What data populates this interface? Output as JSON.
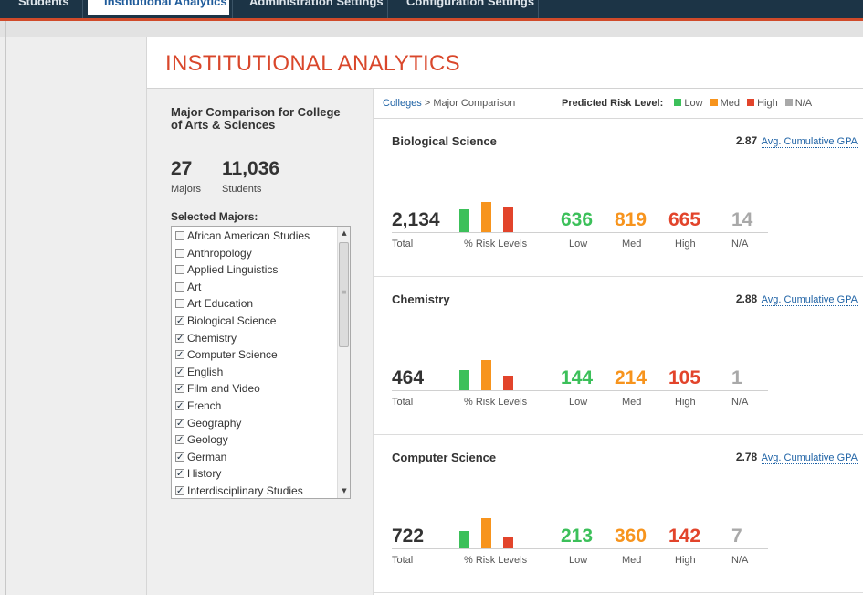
{
  "nav": {
    "tabs": [
      "Students",
      "Institutional Analytics",
      "Administration Settings",
      "Configuration Settings"
    ]
  },
  "page": {
    "title": "INSTITUTIONAL ANALYTICS"
  },
  "sidebar": {
    "heading": "Major Comparison for College of Arts & Sciences",
    "majors_count": "27",
    "majors_label": "Majors",
    "students_count": "11,036",
    "students_label": "Students",
    "selected_label": "Selected Majors:",
    "majors": [
      {
        "label": "African American Studies",
        "checked": false
      },
      {
        "label": "Anthropology",
        "checked": false
      },
      {
        "label": "Applied Linguistics",
        "checked": false
      },
      {
        "label": "Art",
        "checked": false
      },
      {
        "label": "Art Education",
        "checked": false
      },
      {
        "label": "Biological Science",
        "checked": true
      },
      {
        "label": "Chemistry",
        "checked": true
      },
      {
        "label": "Computer Science",
        "checked": true
      },
      {
        "label": "English",
        "checked": true
      },
      {
        "label": "Film and Video",
        "checked": true
      },
      {
        "label": "French",
        "checked": true
      },
      {
        "label": "Geography",
        "checked": true
      },
      {
        "label": "Geology",
        "checked": true
      },
      {
        "label": "German",
        "checked": true
      },
      {
        "label": "History",
        "checked": true
      },
      {
        "label": "Interdisciplinary Studies",
        "checked": true
      }
    ]
  },
  "breadcrumb": {
    "link": "Colleges",
    "sep": " > ",
    "current": "Major Comparison"
  },
  "legend": {
    "title": "Predicted Risk Level:",
    "items": [
      {
        "label": "Low",
        "color": "#3cc05a"
      },
      {
        "label": "Med",
        "color": "#f7941d"
      },
      {
        "label": "High",
        "color": "#e2442b"
      },
      {
        "label": "N/A",
        "color": "#a9a9a9"
      }
    ]
  },
  "labels": {
    "total": "Total",
    "risk_levels": "% Risk Levels",
    "low": "Low",
    "med": "Med",
    "high": "High",
    "na": "N/A",
    "avg_gpa": "Avg. Cumulative GPA"
  },
  "cards": [
    {
      "name": "Biological Science",
      "gpa": "2.87",
      "total": "2,134",
      "low": "636",
      "med": "819",
      "high": "665",
      "na": "14"
    },
    {
      "name": "Chemistry",
      "gpa": "2.88",
      "total": "464",
      "low": "144",
      "med": "214",
      "high": "105",
      "na": "1"
    },
    {
      "name": "Computer Science",
      "gpa": "2.78",
      "total": "722",
      "low": "213",
      "med": "360",
      "high": "142",
      "na": "7"
    }
  ],
  "colors": {
    "low": "#3cc05a",
    "med": "#f7941d",
    "high": "#e2442b",
    "na": "#a9a9a9",
    "accent": "#d9472b"
  }
}
